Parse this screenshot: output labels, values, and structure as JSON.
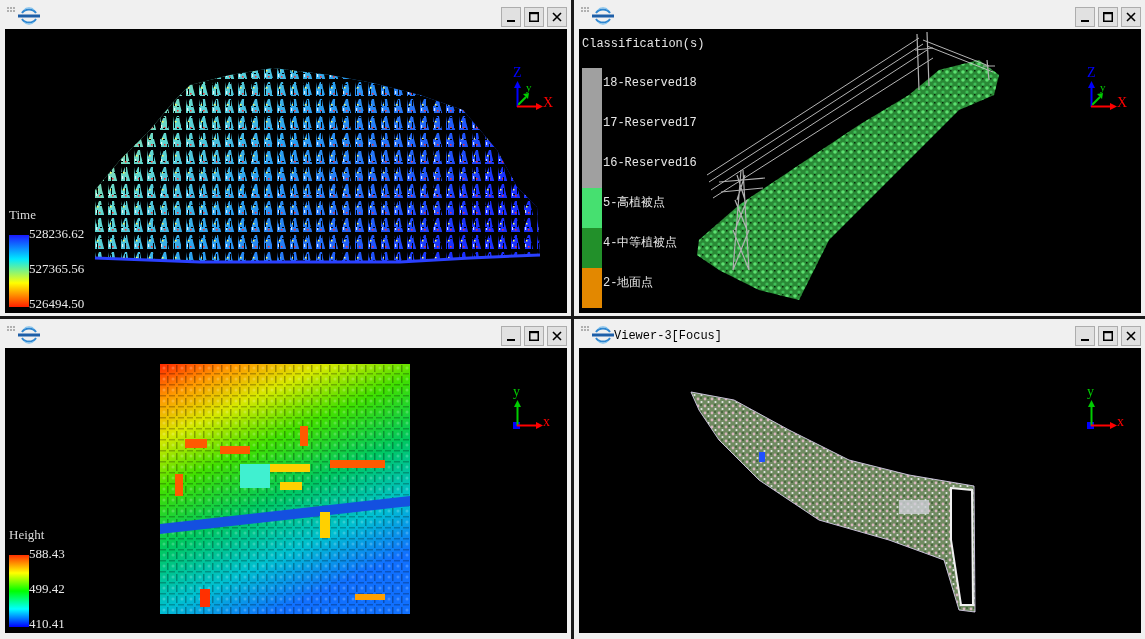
{
  "viewers": [
    {
      "legend": {
        "kind": "gradient",
        "title": "Time",
        "labels": [
          "528236.62",
          "527365.56",
          "526494.50"
        ]
      },
      "axes": [
        {
          "kind": "up",
          "label": "Z",
          "color": "#0000ff"
        },
        {
          "kind": "diagonal",
          "label": "y",
          "color": "#00cc00"
        },
        {
          "kind": "right",
          "label": "X",
          "color": "#ff0000"
        }
      ]
    },
    {
      "legend": {
        "kind": "classes",
        "title": "Classification(s)",
        "classes": [
          {
            "label": "18-Reserved18",
            "color": "#a0a0a0"
          },
          {
            "label": "17-Reserved17",
            "color": "#a0a0a0"
          },
          {
            "label": "16-Reserved16",
            "color": "#a0a0a0"
          },
          {
            "label": "5-高植被点",
            "color": "#46e070"
          },
          {
            "label": "4-中等植被点",
            "color": "#22902a"
          },
          {
            "label": "2-地面点",
            "color": "#e38800"
          }
        ]
      },
      "axes": [
        {
          "kind": "up",
          "label": "Z",
          "color": "#0000ff"
        },
        {
          "kind": "diagonal",
          "label": "y",
          "color": "#00cc00"
        },
        {
          "kind": "right",
          "label": "X",
          "color": "#ff0000"
        }
      ]
    },
    {
      "legend": {
        "kind": "gradient",
        "title": "Height",
        "labels": [
          "588.43",
          "499.42",
          "410.41"
        ]
      },
      "axes": [
        {
          "kind": "point",
          "color": "#0000ff"
        },
        {
          "kind": "up",
          "label": "y",
          "color": "#00cc00"
        },
        {
          "kind": "right",
          "label": "x",
          "color": "#ff0000"
        }
      ]
    },
    {
      "title": "Viewer-3[Focus]",
      "axes": [
        {
          "kind": "point",
          "color": "#0000ff"
        },
        {
          "kind": "up",
          "label": "y",
          "color": "#00cc00"
        },
        {
          "kind": "right",
          "label": "x",
          "color": "#ff0000"
        }
      ]
    }
  ]
}
